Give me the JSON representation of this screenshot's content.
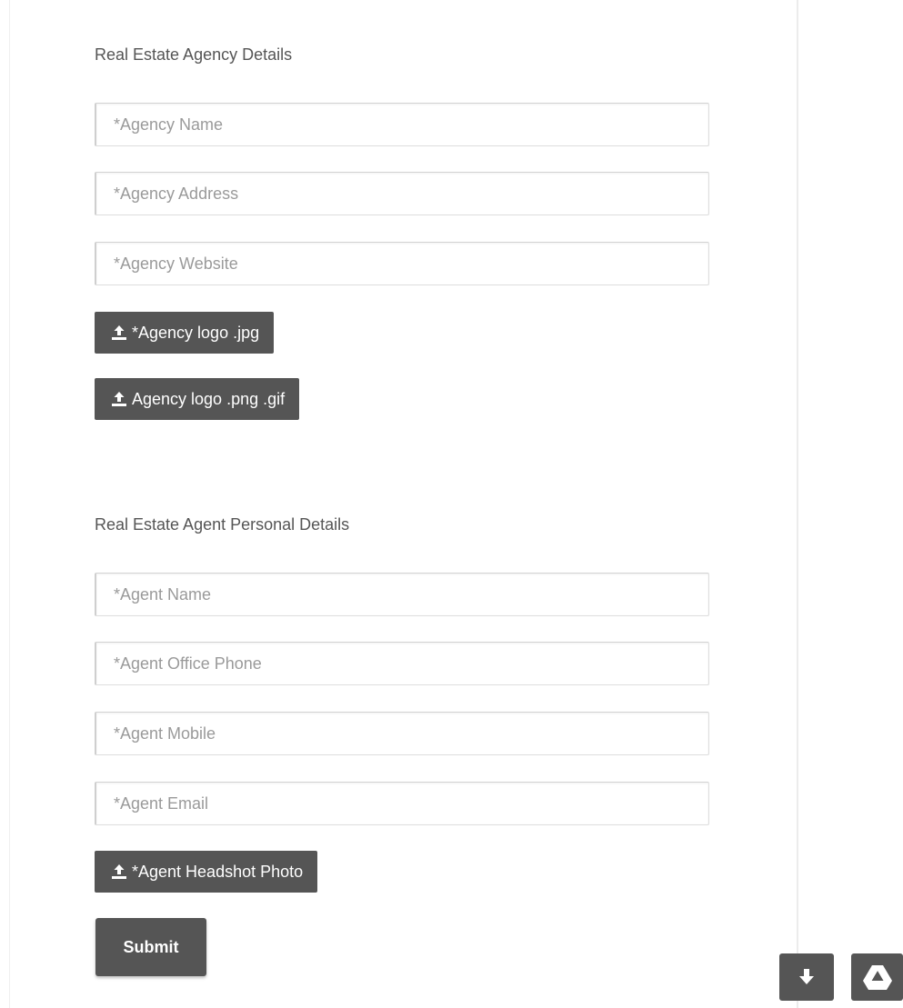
{
  "agency_section": {
    "title": "Real Estate Agency Details",
    "fields": [
      {
        "placeholder": "*Agency Name",
        "value": ""
      },
      {
        "placeholder": "*Agency Address",
        "value": ""
      },
      {
        "placeholder": "*Agency Website",
        "value": ""
      }
    ],
    "uploads": [
      {
        "label": "*Agency logo .jpg",
        "icon": "upload-icon"
      },
      {
        "label": "Agency logo .png .gif",
        "icon": "upload-icon"
      }
    ]
  },
  "agent_section": {
    "title": "Real Estate Agent Personal Details",
    "fields": [
      {
        "placeholder": "*Agent Name",
        "value": ""
      },
      {
        "placeholder": "*Agent Office Phone",
        "value": ""
      },
      {
        "placeholder": "*Agent Mobile",
        "value": ""
      },
      {
        "placeholder": "*Agent Email",
        "value": ""
      }
    ],
    "uploads": [
      {
        "label": "*Agent Headshot Photo",
        "icon": "upload-icon"
      }
    ]
  },
  "submit_label": "Submit",
  "floating_buttons": [
    {
      "icon": "download-arrow-icon"
    },
    {
      "icon": "google-drive-icon"
    }
  ],
  "colors": {
    "button_bg": "#555555",
    "text": "#555555",
    "placeholder": "#9a9a9a"
  }
}
